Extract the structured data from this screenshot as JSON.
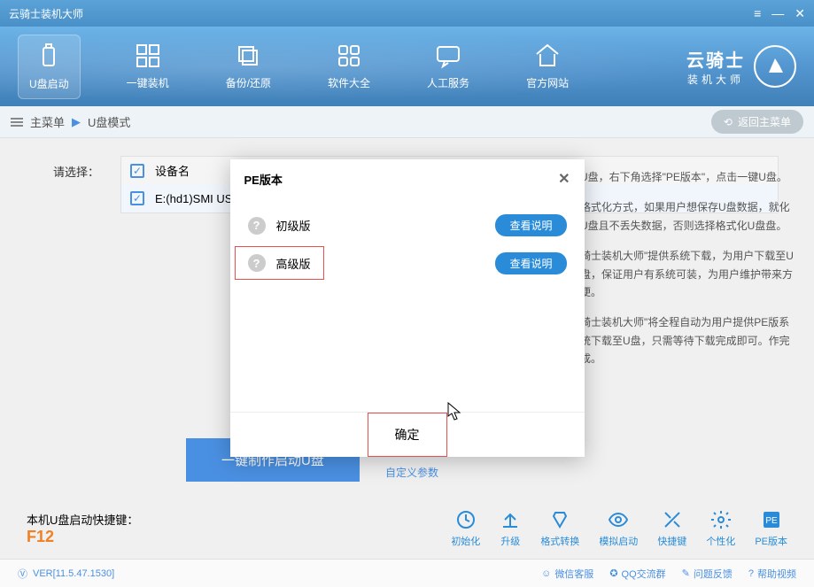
{
  "titlebar": {
    "title": "云骑士装机大师"
  },
  "nav": {
    "items": [
      {
        "label": "U盘启动"
      },
      {
        "label": "一键装机"
      },
      {
        "label": "备份/还原"
      },
      {
        "label": "软件大全"
      },
      {
        "label": "人工服务"
      },
      {
        "label": "官方网站"
      }
    ]
  },
  "brand": {
    "main": "云骑士",
    "sub": "装机大师"
  },
  "breadcrumb": {
    "main": "主菜单",
    "sub": "U盘模式",
    "back": "返回主菜单"
  },
  "form": {
    "label": "请选择：",
    "header_device": "设备名"
  },
  "devices": [
    {
      "name": "E:(hd1)SMI US"
    }
  ],
  "instructions": {
    "p1": "U盘，右下角选择\"PE版本\"，点击一键U盘。",
    "p2": "格式化方式，如果用户想保存U盘数据，就化U盘且不丢失数据，否则选择格式化U盘盘。",
    "p3": "骑士装机大师\"提供系统下载，为用户下载至U盘，保证用户有系统可装，为用户维护带来方便。",
    "p4": "骑士装机大师\"将全程自动为用户提供PE版系统下载至U盘，只需等待下载完成即可。作完成。"
  },
  "main_button": "一键制作启动U盘",
  "custom_link": "自定义参数",
  "hotkey": {
    "label": "本机U盘启动快捷键：",
    "key": "F12"
  },
  "tools": {
    "items": [
      {
        "label": "初始化"
      },
      {
        "label": "升级"
      },
      {
        "label": "格式转换"
      },
      {
        "label": "模拟启动"
      },
      {
        "label": "快捷键"
      },
      {
        "label": "个性化"
      },
      {
        "label": "PE版本"
      }
    ]
  },
  "version": "VER[11.5.47.1530]",
  "footer_links": {
    "items": [
      {
        "label": "微信客服"
      },
      {
        "label": "QQ交流群"
      },
      {
        "label": "问题反馈"
      },
      {
        "label": "帮助视频"
      }
    ]
  },
  "modal": {
    "title": "PE版本",
    "options": [
      {
        "name": "初级版",
        "btn": "查看说明"
      },
      {
        "name": "高级版",
        "btn": "查看说明"
      }
    ],
    "confirm": "确定"
  }
}
